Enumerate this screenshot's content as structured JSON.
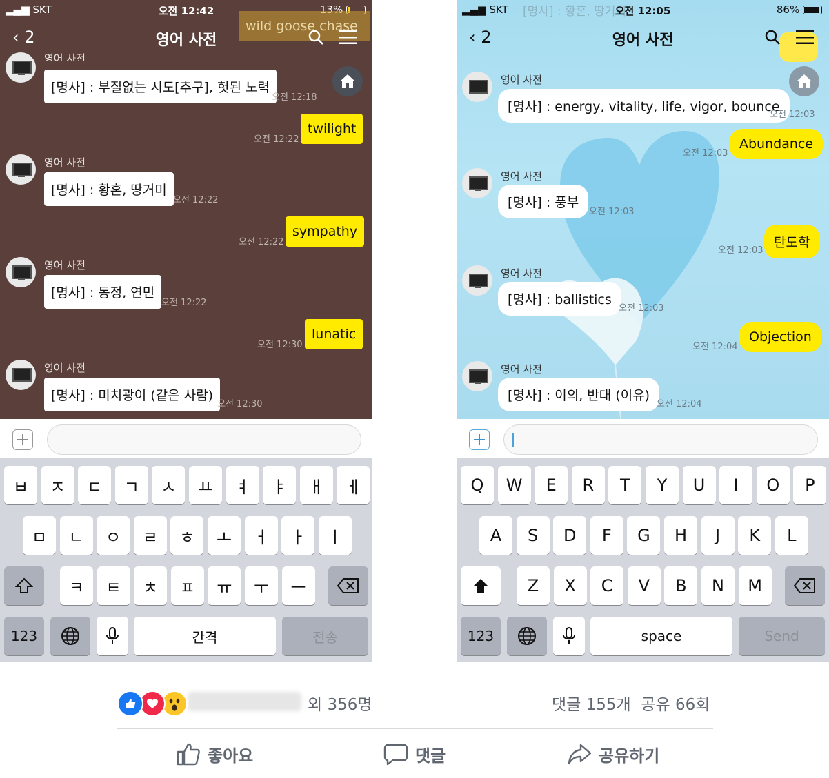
{
  "left": {
    "status": {
      "carrier": "SKT",
      "time": "오전 12:42",
      "battery": "13%"
    },
    "nav": {
      "back": "2",
      "title": "영어 사전"
    },
    "overlay_text": "wild goose chase",
    "top_sender_partial": "영어 사전",
    "messages": [
      {
        "type": "received",
        "text": "[명사] : 부질없는 시도[추구], 헛된 노력",
        "time": "오전 12:18"
      },
      {
        "type": "sent",
        "text": "twilight",
        "time": "오전 12:22"
      },
      {
        "type": "received",
        "sender": "영어 사전",
        "text": "[명사] : 황혼, 땅거미",
        "time": "오전 12:22"
      },
      {
        "type": "sent",
        "text": "sympathy",
        "time": "오전 12:22"
      },
      {
        "type": "received",
        "sender": "영어 사전",
        "text": "[명사] : 동정, 연민",
        "time": "오전 12:22"
      },
      {
        "type": "sent",
        "text": "lunatic",
        "time": "오전 12:30"
      },
      {
        "type": "received",
        "sender": "영어 사전",
        "text": "[명사] : 미치광이 (같은 사람)",
        "time": "오전 12:30"
      }
    ],
    "keyboard": {
      "row1": [
        "ㅂ",
        "ㅈ",
        "ㄷ",
        "ㄱ",
        "ㅅ",
        "ㅛ",
        "ㅕ",
        "ㅑ",
        "ㅐ",
        "ㅔ"
      ],
      "row2": [
        "ㅁ",
        "ㄴ",
        "ㅇ",
        "ㄹ",
        "ㅎ",
        "ㅗ",
        "ㅓ",
        "ㅏ",
        "ㅣ"
      ],
      "row3": [
        "ㅋ",
        "ㅌ",
        "ㅊ",
        "ㅍ",
        "ㅠ",
        "ㅜ",
        "ㅡ"
      ],
      "num": "123",
      "space": "간격",
      "send": "전송"
    }
  },
  "right": {
    "status": {
      "carrier": "SKT",
      "time": "오전 12:05",
      "battery": "86%"
    },
    "nav": {
      "back": "2",
      "title": "영어 사전"
    },
    "ghost_text": "[명사] : 황혼, 땅거미",
    "messages": [
      {
        "type": "received",
        "sender": "영어 사전",
        "text": "[명사] : energy, vitality, life, vigor, bounce",
        "time": "오전 12:03"
      },
      {
        "type": "sent",
        "text": "Abundance",
        "time": "오전 12:03"
      },
      {
        "type": "received",
        "sender": "영어 사전",
        "text": "[명사] : 풍부",
        "time": "오전 12:03"
      },
      {
        "type": "sent",
        "text": "탄도학",
        "time": "오전 12:03"
      },
      {
        "type": "received",
        "sender": "영어 사전",
        "text": "[명사] : ballistics",
        "time": "오전 12:03"
      },
      {
        "type": "sent",
        "text": "Objection",
        "time": "오전 12:04"
      },
      {
        "type": "received",
        "sender": "영어 사전",
        "text": "[명사] : 이의, 반대 (이유)",
        "time": "오전 12:04"
      }
    ],
    "keyboard": {
      "row1": [
        "Q",
        "W",
        "E",
        "R",
        "T",
        "Y",
        "U",
        "I",
        "O",
        "P"
      ],
      "row2": [
        "A",
        "S",
        "D",
        "F",
        "G",
        "H",
        "J",
        "K",
        "L"
      ],
      "row3": [
        "Z",
        "X",
        "C",
        "V",
        "B",
        "N",
        "M"
      ],
      "num": "123",
      "space": "space",
      "send": "Send"
    }
  },
  "footer": {
    "reactions": [
      "like-icon",
      "love-icon",
      "wow-icon"
    ],
    "like_count": "외 356명",
    "comments": "댓글 155개",
    "shares": "공유 66회",
    "actions": {
      "like": "좋아요",
      "comment": "댓글",
      "share": "공유하기"
    }
  },
  "colors": {
    "left_bg": "#5a3f3a",
    "right_bg": "#a6dcf0",
    "sent_bubble": "#ffeb00"
  }
}
